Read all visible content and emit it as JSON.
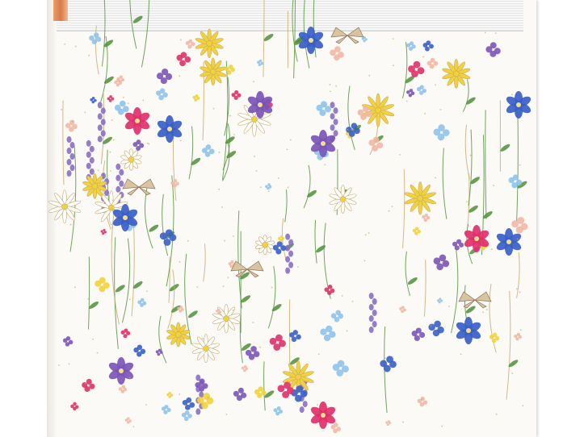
{
  "scene": {
    "subject": "photo-album",
    "pattern": "wildflower-meadow",
    "colors": {
      "cover": "#fbfaf6",
      "lavender": "#8a6fc4",
      "purple": "#7b55b8",
      "pink": "#e0306a",
      "blue": "#3a5fc8",
      "lightblue": "#8ec3ec",
      "yellow": "#f2d23a",
      "peach": "#f2b8a4",
      "green": "#4f8f3a",
      "gold": "#c8a96a",
      "ribbon": "#d9784a"
    }
  }
}
